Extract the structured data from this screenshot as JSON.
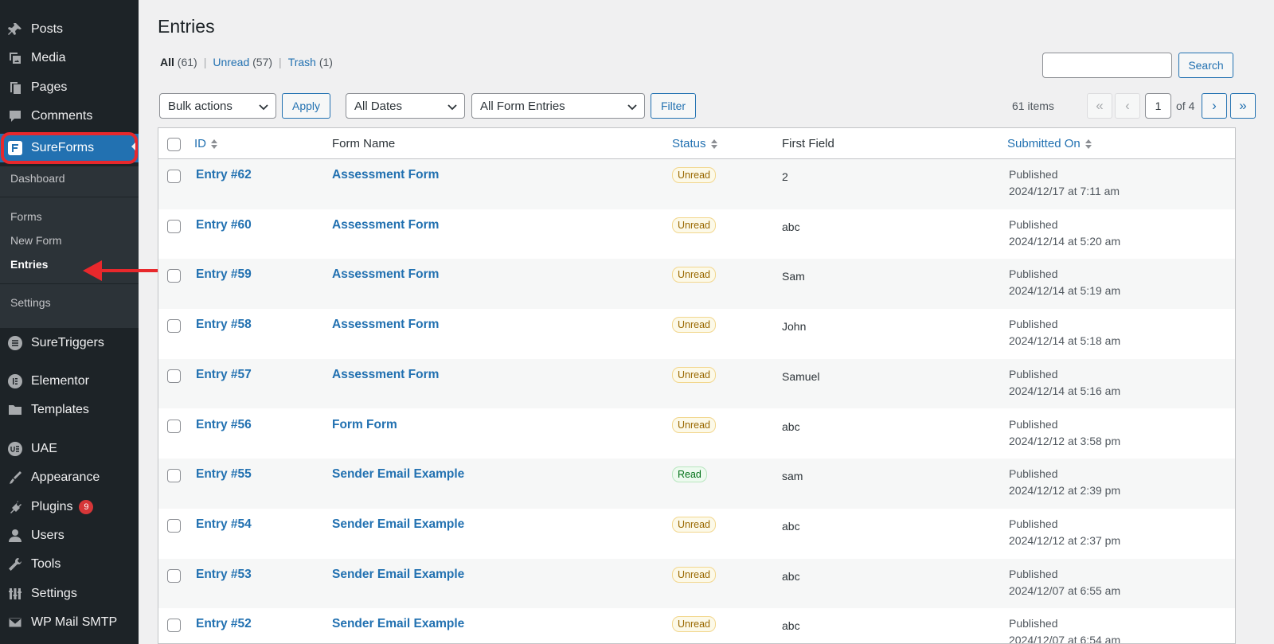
{
  "sidebar": {
    "items": [
      {
        "label": "Posts",
        "icon": "pin-icon"
      },
      {
        "label": "Media",
        "icon": "media-icon"
      },
      {
        "label": "Pages",
        "icon": "pages-icon"
      },
      {
        "label": "Comments",
        "icon": "comment-icon"
      },
      {
        "label": "SureForms",
        "icon": "sureforms-icon"
      },
      {
        "label": "SureTriggers",
        "icon": "suretriggers-icon"
      },
      {
        "label": "Elementor",
        "icon": "elementor-icon"
      },
      {
        "label": "Templates",
        "icon": "folder-icon"
      },
      {
        "label": "UAE",
        "icon": "uae-icon"
      },
      {
        "label": "Appearance",
        "icon": "brush-icon"
      },
      {
        "label": "Plugins",
        "icon": "plugin-icon"
      },
      {
        "label": "Users",
        "icon": "user-icon"
      },
      {
        "label": "Tools",
        "icon": "wrench-icon"
      },
      {
        "label": "Settings",
        "icon": "settings-icon"
      },
      {
        "label": "WP Mail SMTP",
        "icon": "mail-icon"
      }
    ],
    "plugins_badge": "9",
    "submenu": {
      "dashboard": "Dashboard",
      "forms": "Forms",
      "new_form": "New Form",
      "entries": "Entries",
      "settings": "Settings"
    }
  },
  "page": {
    "title": "Entries",
    "views": {
      "all_label": "All",
      "all_count": "(61)",
      "unread_label": "Unread",
      "unread_count": "(57)",
      "trash_label": "Trash",
      "trash_count": "(1)"
    },
    "search_button": "Search",
    "search_value": "",
    "bulk_actions": "Bulk actions",
    "apply": "Apply",
    "dates_filter": "All Dates",
    "form_filter": "All Form Entries",
    "filter_button": "Filter",
    "items_count": "61 items",
    "pagination": {
      "first": "«",
      "prev": "‹",
      "current": "1",
      "of_text": "of 4",
      "next": "›",
      "last": "»"
    }
  },
  "table": {
    "columns": [
      "ID",
      "Form Name",
      "Status",
      "First Field",
      "Submitted On"
    ],
    "rows": [
      {
        "id": "Entry #62",
        "form": "Assessment Form",
        "status": "Unread",
        "first": "2",
        "pub": "Published",
        "date": "2024/12/17 at 7:11 am"
      },
      {
        "id": "Entry #60",
        "form": "Assessment Form",
        "status": "Unread",
        "first": "abc",
        "pub": "Published",
        "date": "2024/12/14 at 5:20 am"
      },
      {
        "id": "Entry #59",
        "form": "Assessment Form",
        "status": "Unread",
        "first": "Sam",
        "pub": "Published",
        "date": "2024/12/14 at 5:19 am"
      },
      {
        "id": "Entry #58",
        "form": "Assessment Form",
        "status": "Unread",
        "first": "John",
        "pub": "Published",
        "date": "2024/12/14 at 5:18 am"
      },
      {
        "id": "Entry #57",
        "form": "Assessment Form",
        "status": "Unread",
        "first": "Samuel",
        "pub": "Published",
        "date": "2024/12/14 at 5:16 am"
      },
      {
        "id": "Entry #56",
        "form": "Form Form",
        "status": "Unread",
        "first": "abc",
        "pub": "Published",
        "date": "2024/12/12 at 3:58 pm"
      },
      {
        "id": "Entry #55",
        "form": "Sender Email Example",
        "status": "Read",
        "first": "sam",
        "pub": "Published",
        "date": "2024/12/12 at 2:39 pm"
      },
      {
        "id": "Entry #54",
        "form": "Sender Email Example",
        "status": "Unread",
        "first": "abc",
        "pub": "Published",
        "date": "2024/12/12 at 2:37 pm"
      },
      {
        "id": "Entry #53",
        "form": "Sender Email Example",
        "status": "Unread",
        "first": "abc",
        "pub": "Published",
        "date": "2024/12/07 at 6:55 am"
      },
      {
        "id": "Entry #52",
        "form": "Sender Email Example",
        "status": "Unread",
        "first": "abc",
        "pub": "Published",
        "date": "2024/12/07 at 6:54 am"
      }
    ]
  },
  "colors": {
    "sidebar_bg": "#1d2327",
    "submenu_bg": "#2c3338",
    "accent": "#2271b1",
    "annotation_red": "#e8282c",
    "unread_badge": "#996800",
    "read_badge": "#007017"
  }
}
